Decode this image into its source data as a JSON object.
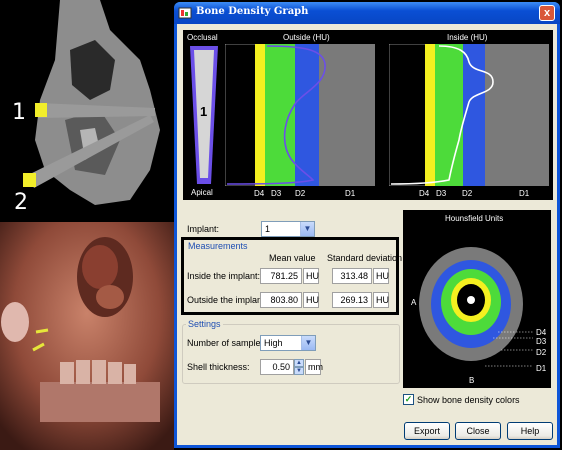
{
  "images": {
    "marker_1": "1",
    "marker_2": "2"
  },
  "dialog": {
    "title": "Bone Density Graph",
    "close_glyph": "x"
  },
  "graph": {
    "left_labels": {
      "top": "Occlusal",
      "bottom": "Apical",
      "center": "1"
    },
    "outside_title": "Outside (HU)",
    "inside_title": "Inside (HU)",
    "zone_labels": [
      "D4",
      "D3",
      "D2",
      "D1"
    ],
    "colors": {
      "d4": "#f4f020",
      "d3": "#4ddb3a",
      "d2": "#2f57e0",
      "d1": "#7a7a7a",
      "curve": "#6b4fe8"
    }
  },
  "implant": {
    "label": "Implant:",
    "value": "1"
  },
  "measurements": {
    "group_title": "Measurements",
    "col_mean": "Mean value",
    "col_std": "Standard deviation",
    "rows": [
      {
        "label": "Inside the implant:",
        "mean": "781.25",
        "mean_unit": "HU",
        "std": "313.48",
        "std_unit": "HU"
      },
      {
        "label": "Outside the implant:",
        "mean": "803.80",
        "mean_unit": "HU",
        "std": "269.13",
        "std_unit": "HU"
      }
    ]
  },
  "settings": {
    "group_title": "Settings",
    "samples_label": "Number of samples:",
    "samples_value": "High",
    "shell_label": "Shell thickness:",
    "shell_value": "0.50",
    "shell_unit": "mm"
  },
  "hounsfield": {
    "title": "Hounsfield Units",
    "label_a": "A",
    "label_b": "B",
    "zones": [
      "D4",
      "D3",
      "D2",
      "D1"
    ]
  },
  "show_colors": {
    "label": "Show bone density colors",
    "checked": true
  },
  "buttons": {
    "export": "Export",
    "close": "Close",
    "help": "Help"
  }
}
